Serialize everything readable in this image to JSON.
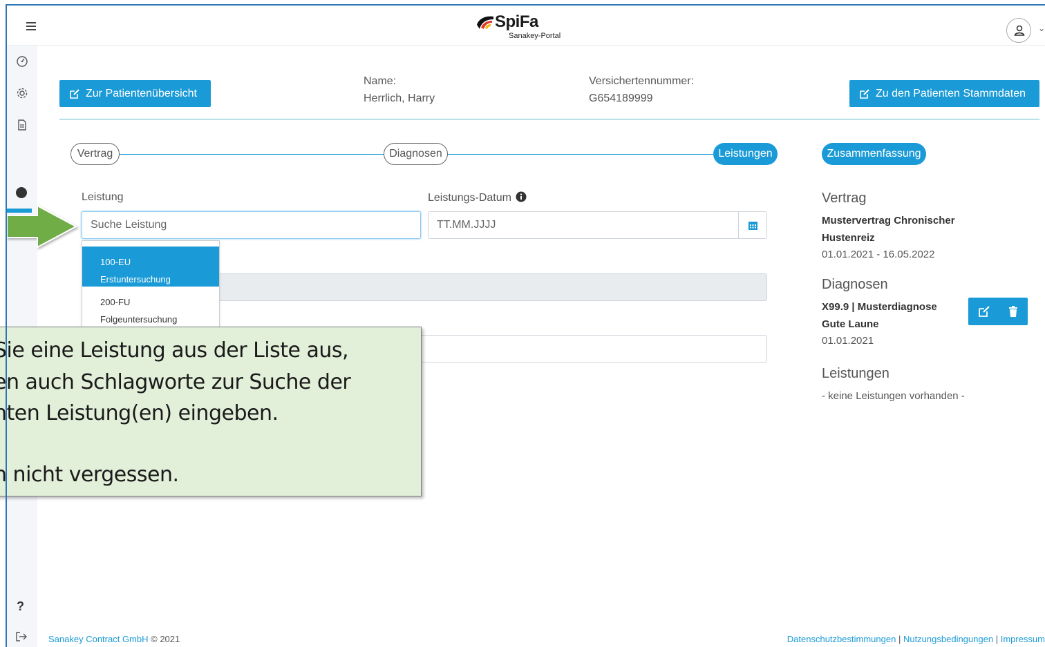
{
  "header": {
    "logo_title": "SpiFa",
    "logo_subtitle": "Sanakey-Portal"
  },
  "patient": {
    "btn_overview": "Zur Patientenübersicht",
    "name_label": "Name:",
    "name_value": "Herrlich, Harry",
    "insurance_label": "Versichertennummer:",
    "insurance_value": "G654189999",
    "btn_master": "Zu den Patienten Stammdaten"
  },
  "stepper": {
    "steps": [
      "Vertrag",
      "Diagnosen",
      "Leistungen",
      "Zusammenfassung"
    ]
  },
  "form": {
    "leistung_label": "Leistung",
    "leistung_placeholder": "Suche Leistung",
    "datum_label": "Leistungs-Datum",
    "datum_placeholder": "TT.MM.JJJJ"
  },
  "dropdown": {
    "items": [
      {
        "code": "100-EU",
        "name": "Erstuntersuchung"
      },
      {
        "code": "200-FU",
        "name": "Folgeuntersuchung"
      }
    ]
  },
  "summary": {
    "vertrag_head": "Vertrag",
    "vertrag_name_1": "Mustervertrag Chronischer",
    "vertrag_name_2": "Hustenreiz",
    "vertrag_dates": "01.01.2021 - 16.05.2022",
    "diagnosen_head": "Diagnosen",
    "diagnose_1": "X99.9 | Musterdiagnose",
    "diagnose_2": "Gute Laune",
    "diagnose_date": "01.01.2021",
    "leistungen_head": "Leistungen",
    "leistungen_empty": "- keine Leistungen vorhanden -"
  },
  "callout": {
    "lines": [
      "Sie eine Leistung aus der Liste aus,",
      "en auch Schlagworte zur Suche der",
      "nten Leistung(en) eingeben.",
      "n nicht vergessen."
    ]
  },
  "footer": {
    "company": "Sanakey Contract GmbH",
    "copyright": "© 2021",
    "link_privacy": "Datenschutzbestimmungen",
    "link_terms": "Nutzungsbedingungen",
    "link_imprint": "Impressum"
  },
  "colors": {
    "accent": "#1a9ad6",
    "callout_bg": "#e2efd9",
    "arrow": "#70ad47"
  }
}
